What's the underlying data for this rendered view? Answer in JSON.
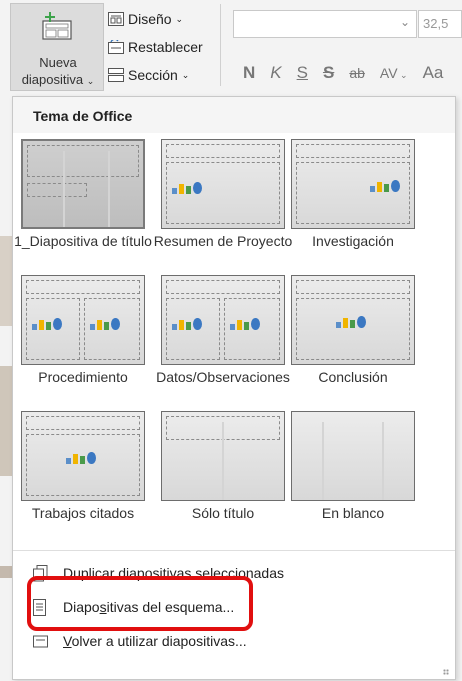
{
  "ribbon": {
    "new_slide_line1": "Nueva",
    "new_slide_line2": "diapositiva",
    "layout_label": "Diseño",
    "reset_label": "Restablecer",
    "section_label": "Sección",
    "font_size": "32,5",
    "format_buttons": {
      "bold": "N",
      "italic": "K",
      "underline": "S",
      "shadow": "S",
      "strike": "ab",
      "spacing": "AV",
      "case": "Aa"
    }
  },
  "dropdown": {
    "section_header": "Tema de Office",
    "layouts": [
      {
        "label": "1_Diapositiva de título"
      },
      {
        "label": "Resumen de Proyecto"
      },
      {
        "label": "Investigación"
      },
      {
        "label": "Procedimiento"
      },
      {
        "label": "Datos/Observaciones"
      },
      {
        "label": "Conclusión"
      },
      {
        "label": "Trabajos citados"
      },
      {
        "label": "Sólo título"
      },
      {
        "label": "En blanco"
      }
    ],
    "menu_items": {
      "duplicate": "Duplicar diapositivas seleccionadas",
      "outline_pre": "Diapo",
      "outline_key": "s",
      "outline_post": "itivas del esquema...",
      "reuse_key": "V",
      "reuse_post": "olver a utilizar diapositivas..."
    }
  },
  "colors": {
    "highlight": "#e10f0f",
    "panel_bg": "#ffffff",
    "header_bg": "#f5f5f5"
  }
}
